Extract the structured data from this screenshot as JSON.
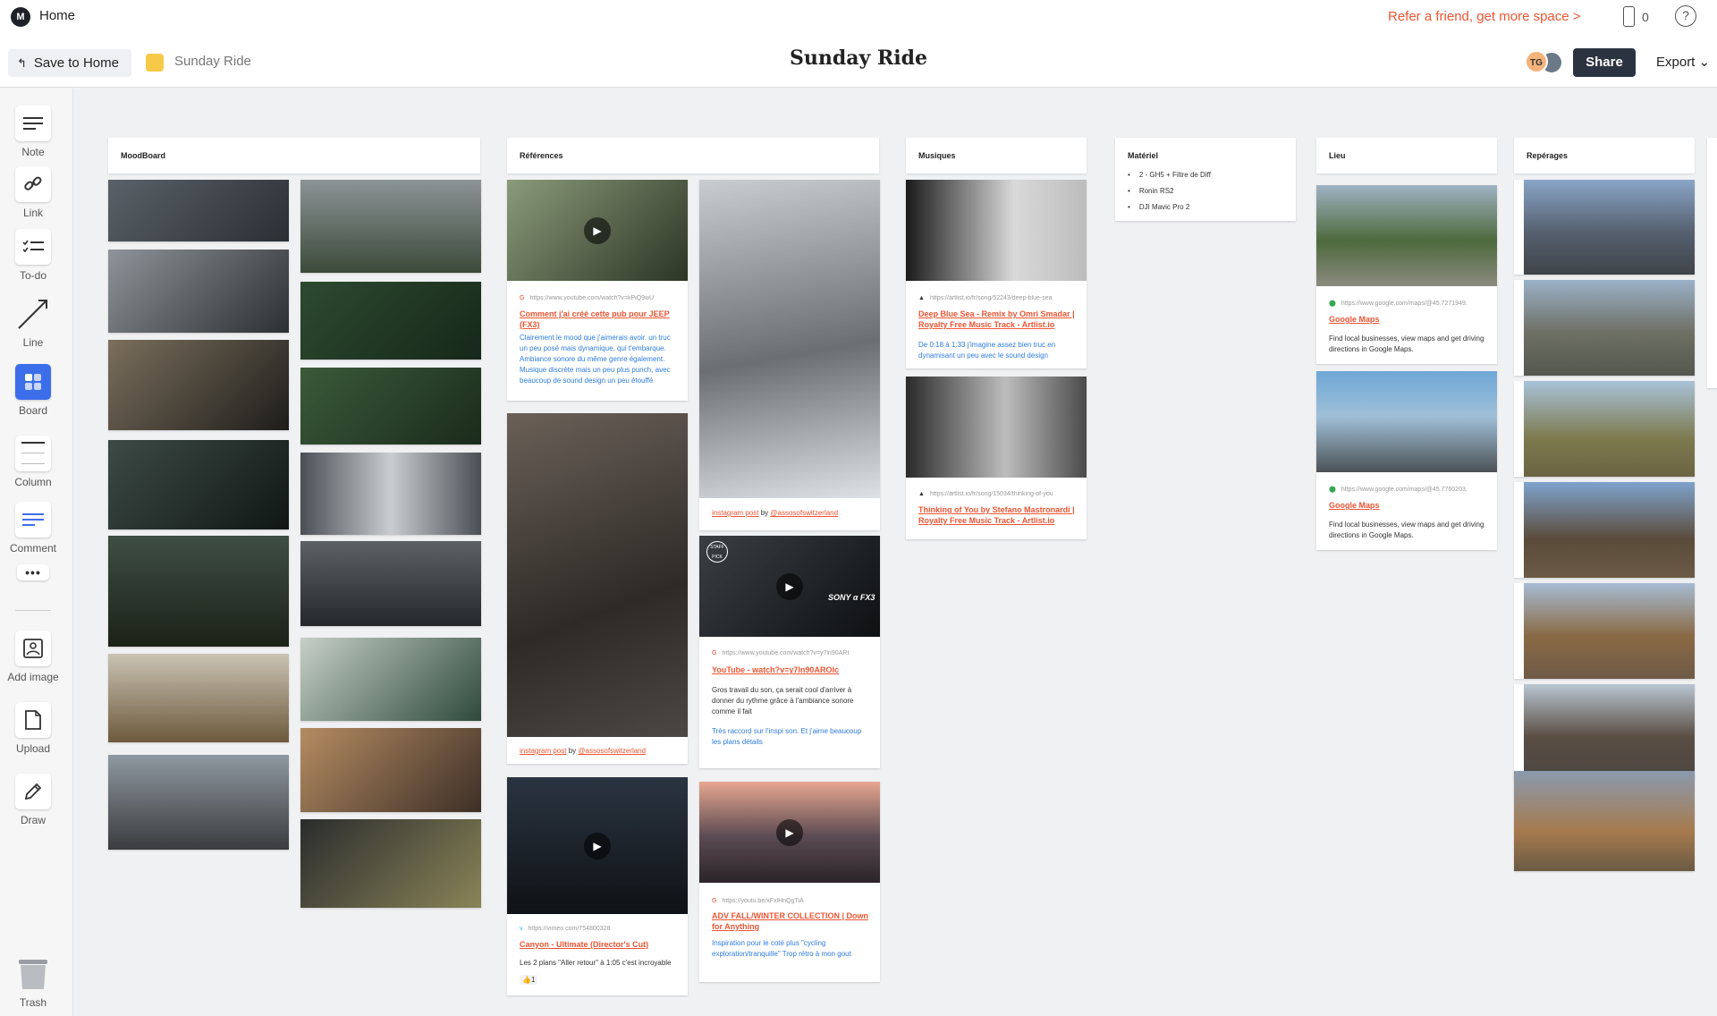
{
  "topbar": {
    "logo": "M",
    "home": "Home",
    "refer": "Refer a friend, get more space >",
    "device_count": "0",
    "help": "?",
    "save_to_home": "Save to Home",
    "board_name": "Sunday Ride",
    "title": "Sunday Ride",
    "avatar_initials": "TG",
    "share": "Share",
    "export": "Export ⌄"
  },
  "sidebar": {
    "note": "Note",
    "link": "Link",
    "todo": "To-do",
    "line": "Line",
    "board": "Board",
    "column": "Column",
    "comment": "Comment",
    "add_image": "Add image",
    "upload": "Upload",
    "draw": "Draw",
    "trash": "Trash"
  },
  "columns": {
    "moodboard": "MoodBoard",
    "references": "Références",
    "musiques": "Musiques",
    "materiel": "Matériel",
    "lieu": "Lieu",
    "reperages": "Repérages"
  },
  "materiel": {
    "items": [
      "2 - GH5 + Filtre de Diff",
      "Ronin RS2",
      "DJI Mavic Pro 2"
    ]
  },
  "references": {
    "card1": {
      "url": "https://www.youtube.com/watch?v=kPiQ9wU",
      "title": "Comment j'ai créé cette pub pour JEEP (FX3)",
      "desc": "Clairement le mood que j'aimerais avoir. un truc un peu posé mais dynamique, qui t'embarque. Ambiance sonore du même genre également. Musique discrète mais un peu plus punch, avec beaucoup de sound design un peu étouffé"
    },
    "card2": {
      "credit_link": "instagram post",
      "credit_by": " by ",
      "credit_user": "@assosofswitzerland"
    },
    "card3": {
      "credit_link": "instagram post",
      "credit_by": " by ",
      "credit_user": "@assosofswitzerland"
    },
    "card4": {
      "url": "https://www.youtube.com/watch?v=y7ln90ARI",
      "title": "YouTube - watch?v=y7ln90AROlc",
      "desc": "Gros travail du son, ça serait cool d'arriver à donner du rythme grâce à l'ambiance sonore comme il fait",
      "note": "Très raccord sur l'inspi son. Et j'aime beaucoup les plans détails",
      "badge1": "STAFF PICK",
      "badge2": "SONY α FX3"
    },
    "card5": {
      "url": "https://vimeo.com/754800328",
      "title": "Canyon - Ultimate (Director's Cut)",
      "desc": "Les 2 plans \"Aller retour\" à 1:05 c'est incroyable",
      "reaction": "👍1"
    },
    "card6": {
      "url": "https://youtu.be/xFxlHnQgTiA",
      "title": "ADV FALL/WINTER COLLECTION | Down for Anything",
      "desc": "Inspiration pour le coté plus \"cycling exploration/tranquille\" Trop rétro à mon gout"
    }
  },
  "musiques": {
    "card1": {
      "url": "https://artlist.io/fr/song/52243/deep-blue-sea",
      "title": "Deep Blue Sea - Remix by Omri Smadar | Royalty Free Music Track - Artlist.io",
      "desc": "De 0:18 à 1:33 j'imagine assez bien truc en dynamisant un peu avec le sound design"
    },
    "card2": {
      "url": "https://artlist.io/fr/song/15034/thinking-of-you",
      "title": "Thinking of You by Stefano Mastronardi | Royalty Free Music Track - Artlist.io"
    }
  },
  "lieu": {
    "card1": {
      "url": "https://www.google.com/maps/@45.7271949,",
      "title": "Google Maps",
      "desc": "Find local businesses, view maps and get driving directions in Google Maps."
    },
    "card2": {
      "url": "https://www.google.com/maps/@45.7760203,",
      "title": "Google Maps",
      "desc": "Find local businesses, view maps and get driving directions in Google Maps."
    }
  },
  "colors": {
    "accent": "#ee5533",
    "link_blue": "#2e7de0",
    "share_bg": "#2c3340",
    "board_blue": "#3d6eea",
    "board_swatch": "#f7c948"
  }
}
